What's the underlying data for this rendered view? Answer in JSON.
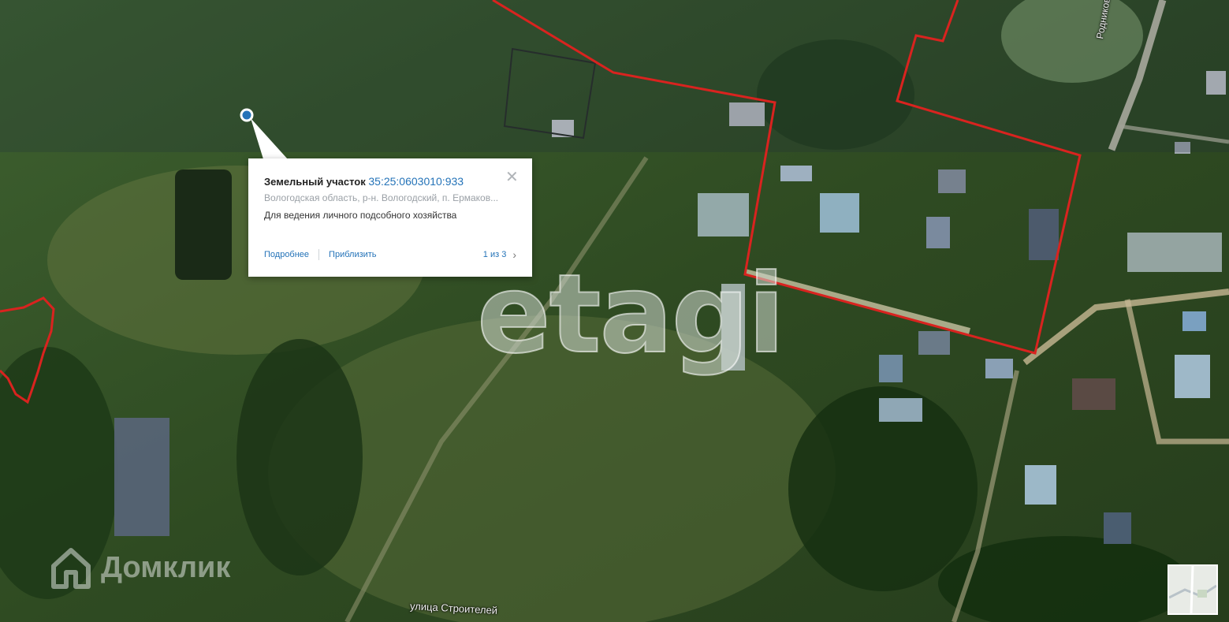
{
  "popup": {
    "title": "Земельный участок",
    "cadastral_number": "35:25:0603010:933",
    "address": "Вологодская область, р-н. Вологодский, п. Ермаков...",
    "description": "Для ведения личного подсобного хозяйства",
    "more_label": "Подробнее",
    "zoom_label": "Приблизить",
    "pager": "1 из 3",
    "close_icon": "close-icon",
    "next_icon": "chevron-right-icon"
  },
  "watermarks": {
    "etagi": "etagi",
    "domclick": "Домклик",
    "domclick_icon": "house-icon"
  },
  "streets": {
    "stroiteley": "улица Строителей",
    "rodnikovaya": "Родниковая улица"
  },
  "colors": {
    "boundary": "#d9231f",
    "link": "#2473b8",
    "marker": "#2473b8"
  },
  "minimap": {
    "icon": "minimap-icon"
  }
}
